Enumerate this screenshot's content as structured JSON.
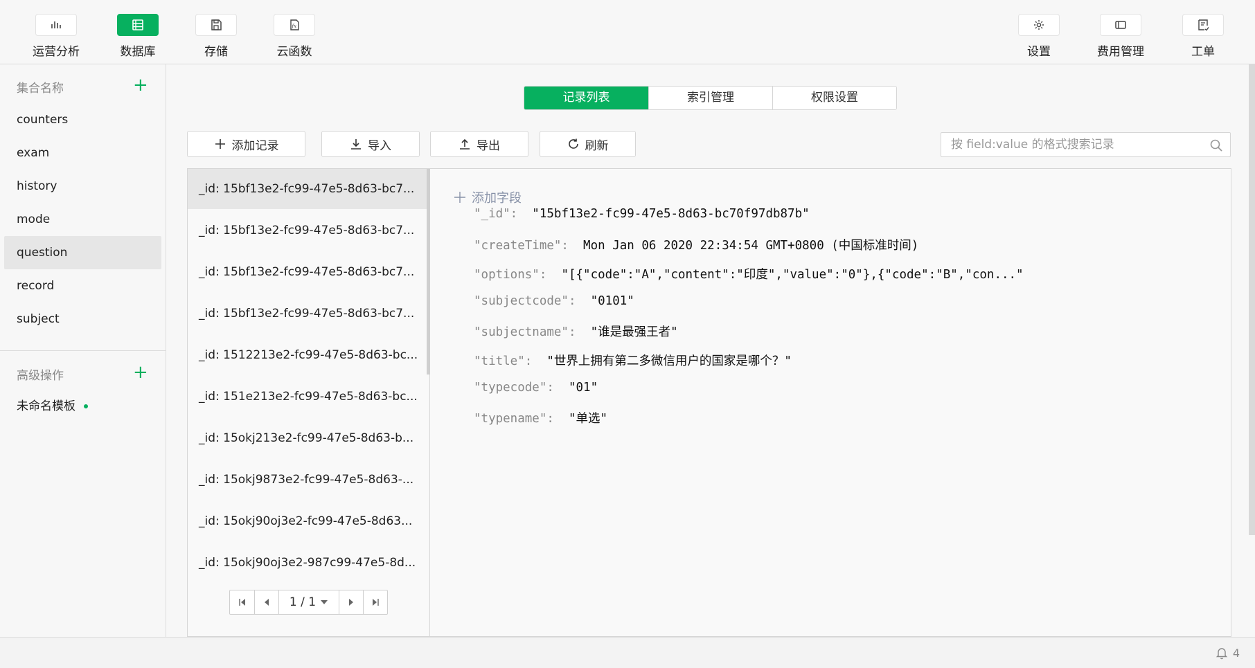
{
  "toolbar": {
    "left": [
      {
        "label": "运营分析",
        "icon": "bar-chart-icon"
      },
      {
        "label": "数据库",
        "icon": "database-icon"
      },
      {
        "label": "存储",
        "icon": "save-icon"
      },
      {
        "label": "云函数",
        "icon": "function-icon"
      }
    ],
    "right": [
      {
        "label": "设置",
        "icon": "gear-icon"
      },
      {
        "label": "费用管理",
        "icon": "billing-icon"
      },
      {
        "label": "工单",
        "icon": "ticket-icon"
      }
    ]
  },
  "sidebar": {
    "collections_header": "集合名称",
    "collections": [
      "counters",
      "exam",
      "history",
      "mode",
      "question",
      "record",
      "subject"
    ],
    "active_collection": "question",
    "advanced_header": "高级操作",
    "templates": [
      "未命名模板"
    ]
  },
  "tabs": [
    "记录列表",
    "索引管理",
    "权限设置"
  ],
  "actions": {
    "add": "添加记录",
    "import": "导入",
    "export": "导出",
    "refresh": "刷新"
  },
  "search": {
    "placeholder": "按 field:value 的格式搜索记录"
  },
  "records": [
    "_id: 15bf13e2-fc99-47e5-8d63-bc7...",
    "_id: 15bf13e2-fc99-47e5-8d63-bc7...",
    "_id: 15bf13e2-fc99-47e5-8d63-bc7...",
    "_id: 15bf13e2-fc99-47e5-8d63-bc7...",
    "_id: 1512213e2-fc99-47e5-8d63-bc...",
    "_id: 151e213e2-fc99-47e5-8d63-bc...",
    "_id: 15okj213e2-fc99-47e5-8d63-b...",
    "_id: 15okj9873e2-fc99-47e5-8d63-...",
    "_id: 15okj90oj3e2-fc99-47e5-8d63...",
    "_id: 15okj90oj3e2-987c99-47e5-8d..."
  ],
  "pager": {
    "label": "1 / 1"
  },
  "detail": {
    "add_field": "添加字段",
    "fields": [
      {
        "key": "\"_id\":",
        "value": "\"15bf13e2-fc99-47e5-8d63-bc70f97db87b\""
      },
      {
        "key": "\"createTime\":",
        "value": "Mon Jan 06 2020 22:34:54 GMT+0800 (中国标准时间)"
      },
      {
        "key": "\"options\":",
        "value": "\"[{\"code\":\"A\",\"content\":\"印度\",\"value\":\"0\"},{\"code\":\"B\",\"con...\""
      },
      {
        "key": "\"subjectcode\":",
        "value": "\"0101\""
      },
      {
        "key": "\"subjectname\":",
        "value": "\"谁是最强王者\""
      },
      {
        "key": "\"title\":",
        "value": "\"世界上拥有第二多微信用户的国家是哪个？\""
      },
      {
        "key": "\"typecode\":",
        "value": "\"01\""
      },
      {
        "key": "\"typename\":",
        "value": "\"单选\""
      }
    ]
  },
  "status": {
    "notification_count": "4"
  },
  "colors": {
    "accent": "#07b05f",
    "selected_row": "#e6e6e6"
  }
}
